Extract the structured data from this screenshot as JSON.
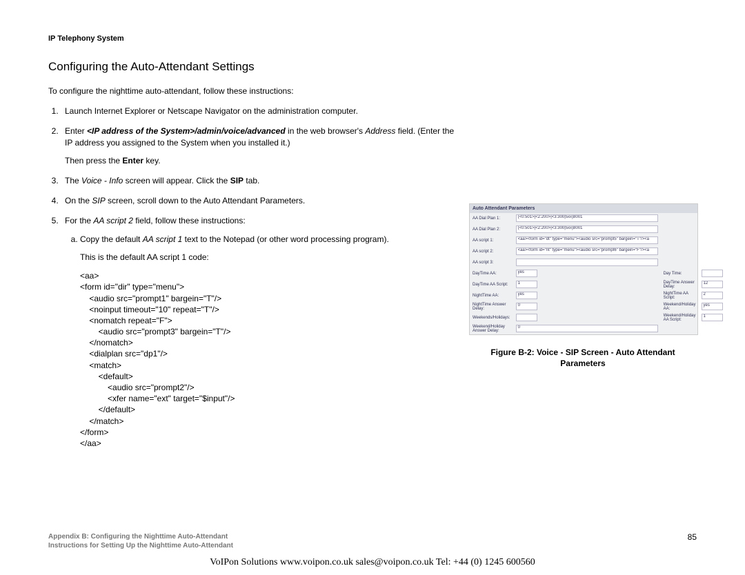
{
  "header": "IP Telephony System",
  "section_title": "Configuring the Auto-Attendant Settings",
  "intro": "To configure the nighttime auto-attendant, follow these instructions:",
  "step1": "Launch Internet Explorer or Netscape Navigator on the administration computer.",
  "step2_a": "Enter ",
  "step2_b": "<IP address of the System>/admin/voice/advanced",
  "step2_c": " in the web browser's ",
  "step2_d": "Address",
  "step2_e": " field. (Enter the IP address you assigned to the System when you installed it.)",
  "step2_f": "Then press the ",
  "step2_g": "Enter",
  "step2_h": " key.",
  "step3_a": "The ",
  "step3_b": "Voice - Info",
  "step3_c": " screen will appear. Click the ",
  "step3_d": "SIP",
  "step3_e": " tab.",
  "step4_a": "On the ",
  "step4_b": "SIP",
  "step4_c": " screen, scroll down to the Auto Attendant Parameters.",
  "step5_a": "For the ",
  "step5_b": "AA script 2",
  "step5_c": " field, follow these instructions:",
  "step5a_a": "Copy the default ",
  "step5a_b": "AA script 1",
  "step5a_c": " text to the Notepad (or other word processing program).",
  "step5a_d": "This is the default AA script 1 code:",
  "code": "<aa>\n<form id=\"dir\" type=\"menu\">\n    <audio src=\"prompt1\" bargein=\"T\"/>\n    <noinput timeout=\"10\" repeat=\"T\"/>\n    <nomatch repeat=\"F\">\n        <audio src=\"prompt3\" bargein=\"T\"/>\n    </nomatch>\n    <dialplan src=\"dp1\"/>\n    <match>\n        <default>\n            <audio src=\"prompt2\"/>\n            <xfer name=\"ext\" target=\"$input\"/>\n        </default>\n    </match>\n</form>\n</aa>",
  "figure": {
    "header": "Auto Attendant Parameters",
    "rows": [
      [
        "AA Dial Plan 1:",
        "(<0:501>|<2:200>|<3:300|5xx)8001",
        "",
        ""
      ],
      [
        "AA Dial Plan 2:",
        "(<0:501>|<2:200>|<3:300|5xx)8001",
        "",
        ""
      ],
      [
        "AA script 1:",
        "<aa><form id=\"dt\" type=\"menu\"><audio src=\"prompt5\" bargein=\"T\"/><a",
        "",
        ""
      ],
      [
        "AA script 2:",
        "<aa><form id=\"nt\" type=\"menu\"><audio src=\"prompt6\" bargein=\"F\"/><a",
        "",
        ""
      ],
      [
        "AA script 3:",
        "",
        "",
        ""
      ],
      [
        "DayTime AA:",
        "yes",
        "Day Time:",
        ""
      ],
      [
        "DayTime AA Script:",
        "1",
        "DayTime Answer Delay:",
        "12"
      ],
      [
        "NightTime AA:",
        "yes",
        "NightTime AA Script:",
        "2"
      ],
      [
        "NightTime Answer Delay:",
        "0",
        "Weekend/Holiday AA:",
        "yes"
      ],
      [
        "Weekends/Holidays:",
        "",
        "Weekend/Holiday AA Script:",
        "1"
      ],
      [
        "Weekend/Holiday Answer Delay:",
        "0",
        "",
        ""
      ]
    ],
    "caption_line1": "Figure B-2: Voice - SIP Screen - Auto Attendant",
    "caption_line2": "Parameters"
  },
  "footer": {
    "line1": "Appendix B: Configuring the Nighttime Auto-Attendant",
    "line2": "Instructions for Setting Up the Nighttime Auto-Attendant",
    "page_num": "85"
  },
  "bottom": "VoIPon Solutions  www.voipon.co.uk  sales@voipon.co.uk  Tel: +44 (0) 1245 600560"
}
